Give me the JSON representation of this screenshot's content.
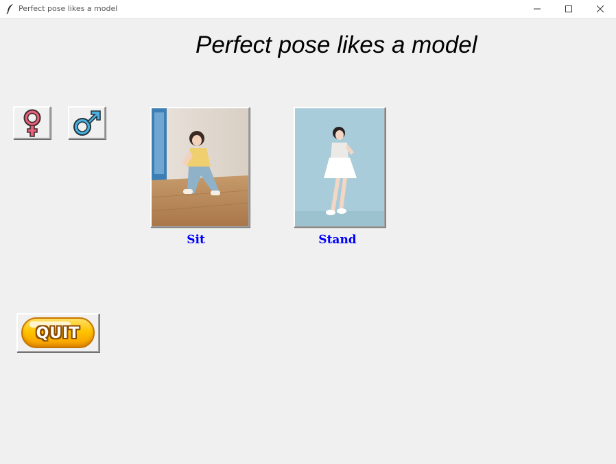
{
  "window": {
    "title": "Perfect pose likes a model",
    "app_icon": "feather-icon",
    "controls": [
      "minimize-icon",
      "maximize-icon",
      "close-icon"
    ]
  },
  "main": {
    "heading": "Perfect pose likes a model",
    "gender_buttons": [
      {
        "icon": "female-symbol-icon",
        "color": "#e8607a"
      },
      {
        "icon": "male-symbol-icon",
        "color": "#4ab0e0"
      }
    ],
    "pose_buttons": [
      {
        "label": "Sit",
        "image": "sitting-model-photo"
      },
      {
        "label": "Stand",
        "image": "standing-model-photo"
      }
    ],
    "quit_label": "QUIT"
  },
  "colors": {
    "background": "#f0f0f0",
    "caption": "#0000ff",
    "quit_yellow": "#ffc400"
  }
}
